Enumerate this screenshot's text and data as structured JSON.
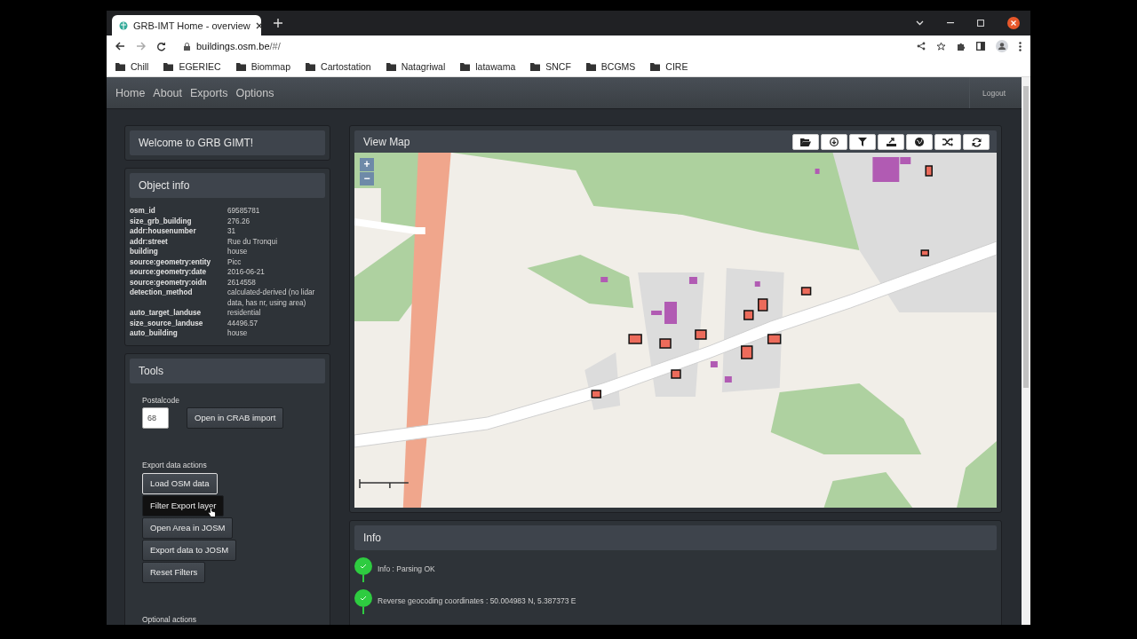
{
  "browser": {
    "tab_title": "GRB-IMT Home - overview",
    "url_host": "buildings.osm.be",
    "url_path": "/#/",
    "bookmarks": [
      "Chill",
      "EGERIEC",
      "Biommap",
      "Cartostation",
      "Natagriwal",
      "latawama",
      "SNCF",
      "BCGMS",
      "CIRE"
    ]
  },
  "navbar": {
    "links": [
      "Home",
      "About",
      "Exports",
      "Options"
    ],
    "logout": "Logout"
  },
  "welcome": {
    "title": "Welcome to GRB GIMT!"
  },
  "object_info": {
    "title": "Object info",
    "rows": [
      {
        "key": "osm_id",
        "value": "69585781"
      },
      {
        "key": "size_grb_building",
        "value": "276.26"
      },
      {
        "key": "addr:housenumber",
        "value": "31"
      },
      {
        "key": "addr:street",
        "value": "Rue du Tronqui"
      },
      {
        "key": "building",
        "value": "house"
      },
      {
        "key": "source:geometry:entity",
        "value": "Picc"
      },
      {
        "key": "source:geometry:date",
        "value": "2016-06-21"
      },
      {
        "key": "source:geometry:oidn",
        "value": "2614558"
      },
      {
        "key": "detection_method",
        "value": "calculated-derived (no lidar data, has nr, using area)"
      },
      {
        "key": "auto_target_landuse",
        "value": "residential"
      },
      {
        "key": "size_source_landuse",
        "value": "44496.57"
      },
      {
        "key": "auto_building",
        "value": "house"
      }
    ]
  },
  "tools": {
    "title": "Tools",
    "postalcode_label": "Postalcode",
    "postalcode_value": "68",
    "crab_button": "Open in CRAB import",
    "export_label": "Export data actions",
    "export_buttons": [
      {
        "label": "Load OSM data",
        "focused": true,
        "hovered": false
      },
      {
        "label": "Filter Export layer",
        "focused": false,
        "hovered": true
      },
      {
        "label": "Open Area in JOSM",
        "focused": false,
        "hovered": false
      },
      {
        "label": "Export data to JOSM",
        "focused": false,
        "hovered": false
      },
      {
        "label": "Reset Filters",
        "focused": false,
        "hovered": false
      }
    ],
    "optional_label": "Optional actions"
  },
  "map": {
    "title": "View Map",
    "zoom_in": "+",
    "zoom_out": "−"
  },
  "info": {
    "title": "Info",
    "messages": [
      "Info : Parsing OK",
      "Reverse geocoding coordinates : 50.004983 N, 5.387373 E"
    ]
  }
}
